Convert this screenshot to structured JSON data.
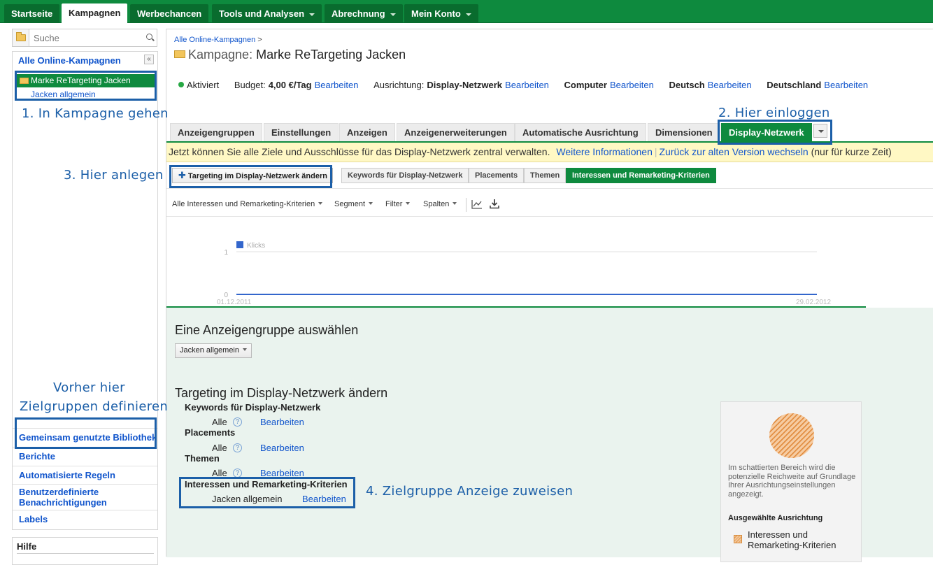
{
  "topnav": {
    "tabs": [
      {
        "label": "Startseite",
        "active": false,
        "dropdown": false
      },
      {
        "label": "Kampagnen",
        "active": true,
        "dropdown": false
      },
      {
        "label": "Werbechancen",
        "active": false,
        "dropdown": false
      },
      {
        "label": "Tools und Analysen",
        "active": false,
        "dropdown": true
      },
      {
        "label": "Abrechnung",
        "active": false,
        "dropdown": true
      },
      {
        "label": "Mein Konto",
        "active": false,
        "dropdown": true
      }
    ]
  },
  "sidebar": {
    "search_placeholder": "Suche",
    "all_campaigns": "Alle Online-Kampagnen",
    "collapse_glyph": "«",
    "campaign": "Marke ReTargeting Jacken",
    "adgroup": "Jacken allgemein",
    "links": [
      "Gemeinsam genutzte Bibliothek",
      "Berichte",
      "Automatisierte Regeln",
      "Benutzerdefinierte Benachrichtigungen",
      "Labels"
    ],
    "help_title": "Hilfe"
  },
  "annotations": {
    "step1": "1. In Kampagne gehen",
    "step2": "2. Hier einloggen",
    "step3": "3. Hier anlegen",
    "step4": "4. Zielgruppe Anzeige zuweisen",
    "before_line1": "Vorher hier",
    "before_line2": "Zielgruppen definieren",
    "color": "#1c5fa8"
  },
  "main": {
    "breadcrumb": "Alle Online-Kampagnen",
    "breadcrumb_sep": ">",
    "title_prefix": "Kampagne:",
    "title": "Marke ReTargeting Jacken",
    "status": {
      "state": "Aktiviert",
      "budget_label": "Budget:",
      "budget_value": "4,00 €/Tag",
      "edit": "Bearbeiten",
      "targeting_label": "Ausrichtung:",
      "targeting_value": "Display-Netzwerk",
      "device": "Computer",
      "language": "Deutsch",
      "country": "Deutschland"
    },
    "tabs": [
      {
        "label": "Anzeigengruppen",
        "active": false
      },
      {
        "label": "Einstellungen",
        "active": false
      },
      {
        "label": "Anzeigen",
        "active": false
      },
      {
        "label": "Anzeigenerweiterungen",
        "active": false
      },
      {
        "label": "Automatische Ausrichtung",
        "active": false
      },
      {
        "label": "Dimensionen",
        "active": false
      },
      {
        "label": "Display-Netzwerk",
        "active": true
      }
    ],
    "notice": {
      "text": "Jetzt können Sie alle Ziele und Ausschlüsse für das Display-Netzwerk zentral verwalten.",
      "link1": "Weitere Informationen",
      "link2": "Zurück zur alten Version wechseln",
      "suffix": "(nur für kurze Zeit)"
    },
    "targeting_button": "Targeting im Display-Netzwerk ändern",
    "subtabs": [
      {
        "label": "Keywords für Display-Netzwerk",
        "active": false
      },
      {
        "label": "Placements",
        "active": false
      },
      {
        "label": "Themen",
        "active": false
      },
      {
        "label": "Interessen und Remarketing-Kriterien",
        "active": true
      }
    ],
    "filters": [
      "Alle Interessen und Remarketing-Kriterien",
      "Segment",
      "Filter",
      "Spalten"
    ],
    "lower": {
      "select_title": "Eine Anzeigengruppe auswählen",
      "select_value": "Jacken allgemein",
      "targeting_heading": "Targeting im Display-Netzwerk ändern",
      "sections": [
        {
          "title": "Keywords für Display-Netzwerk",
          "value": "Alle",
          "edit": "Bearbeiten"
        },
        {
          "title": "Placements",
          "value": "Alle",
          "edit": "Bearbeiten"
        },
        {
          "title": "Themen",
          "value": "Alle",
          "edit": "Bearbeiten"
        },
        {
          "title": "Interessen und Remarketing-Kriterien",
          "value": "Jacken allgemein",
          "edit": "Bearbeiten"
        }
      ],
      "help_glyph": "?",
      "reach": {
        "text": "Im schattierten Bereich wird die potenzielle Reichweite auf Grundlage Ihrer Ausrichtungseinstellungen angezeigt.",
        "selected_title": "Ausgewählte Ausrichtung",
        "legend": "Interessen und Remarketing-Kriterien"
      }
    }
  },
  "chart_data": {
    "type": "line",
    "series": [
      {
        "name": "Klicks",
        "color": "#3366cc",
        "x": [
          "01.12.2011",
          "29.02.2012"
        ],
        "values": [
          0,
          0
        ]
      }
    ],
    "x_tick_labels": [
      "01.12.2011",
      "29.02.2012"
    ],
    "y_tick_labels": [
      "1",
      "0"
    ],
    "ylim": [
      0,
      1
    ],
    "legend": "top-left"
  },
  "icons": {
    "search": "search-icon",
    "folder": "folder-icon",
    "chart": "line-chart-icon",
    "download": "download-icon"
  }
}
